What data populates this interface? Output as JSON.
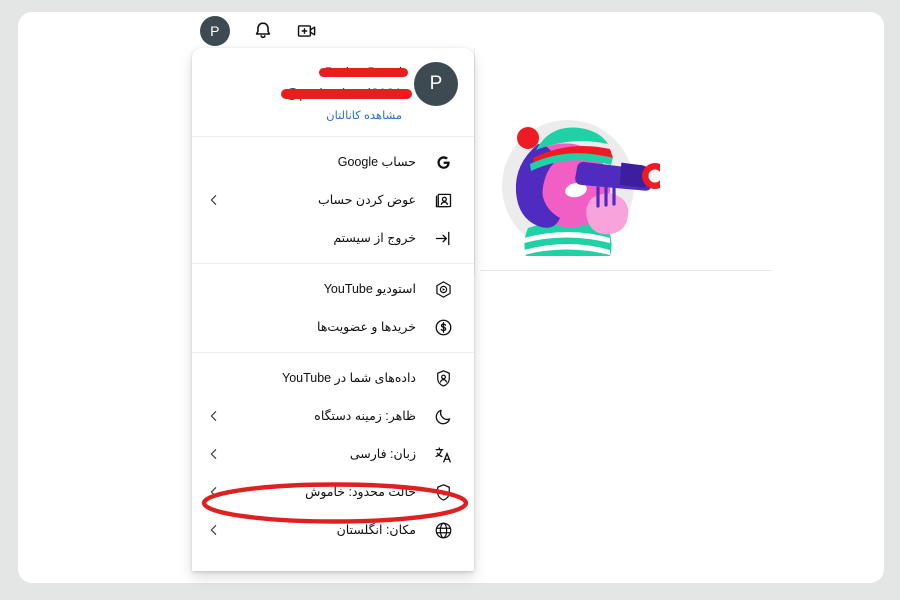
{
  "header": {
    "avatar_initial": "P",
    "icons": [
      {
        "name": "notifications-bell-icon",
        "label": "اعلان‌ها"
      },
      {
        "name": "create-video-icon",
        "label": "ایجاد"
      }
    ]
  },
  "account_menu": {
    "avatar_initial": "P",
    "display_name_redacted": "Pariaa Dozai",
    "handle_redacted": "@parisadozai2101",
    "view_channel_label": "مشاهده کانالتان",
    "sections": [
      {
        "id": "account-section",
        "items": [
          {
            "name": "menu-item-google-account",
            "icon": "google-g-icon",
            "label": "حساب Google",
            "has_chevron": false
          },
          {
            "name": "menu-item-switch-account",
            "icon": "switch-account-icon",
            "label": "عوض کردن حساب",
            "has_chevron": true
          },
          {
            "name": "menu-item-sign-out",
            "icon": "sign-out-icon",
            "label": "خروج از سیستم",
            "has_chevron": false
          }
        ]
      },
      {
        "id": "studio-section",
        "items": [
          {
            "name": "menu-item-youtube-studio",
            "icon": "youtube-studio-icon",
            "label": "استودیو YouTube",
            "has_chevron": false
          },
          {
            "name": "menu-item-purchases-memberships",
            "icon": "dollar-circle-icon",
            "label": "خریدها و عضویت‌ها",
            "has_chevron": false
          }
        ]
      },
      {
        "id": "settings-section",
        "items": [
          {
            "name": "menu-item-your-data-in-youtube",
            "icon": "shield-person-icon",
            "label": "داده‌های شما در YouTube",
            "has_chevron": false
          },
          {
            "name": "menu-item-appearance",
            "icon": "moon-icon",
            "label": "ظاهر: زمینه دستگاه",
            "has_chevron": true
          },
          {
            "name": "menu-item-language",
            "icon": "translate-icon",
            "label": "زبان: فارسی",
            "has_chevron": true
          },
          {
            "name": "menu-item-restricted-mode",
            "icon": "shield-lock-icon",
            "label": "حالت محدود: خاموش",
            "has_chevron": true
          },
          {
            "name": "menu-item-location",
            "icon": "globe-icon",
            "label": "مکان: انگلستان",
            "has_chevron": true
          }
        ]
      }
    ]
  },
  "annotations": {
    "redaction_color": "#ea1c1c",
    "highlight_color": "#e01f1f",
    "highlighted_item": "حالت محدود: خاموش"
  },
  "background": {
    "illustration_name": "person-with-telescope-illustration",
    "illustration_colors": {
      "hair": "#4f2bbf",
      "face": "#f25fc4",
      "hat": "#1fd1a5",
      "hat_stripe": "#ee1b24",
      "pompom": "#ee1b24",
      "telescope": "#4f2bbf",
      "lens_ring": "#ee1b24",
      "backdrop": "#ececec"
    }
  },
  "theme": {
    "page_background": "#e3e6e5",
    "frame_background": "#ffffff",
    "link_color": "#2b6fd4",
    "avatar_background": "#3d4a52"
  }
}
